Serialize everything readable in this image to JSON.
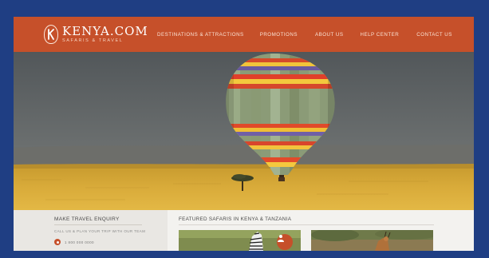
{
  "brand": {
    "name": "KENYA.COM",
    "tagline": "SAFARIS & TRAVEL",
    "logo_icon": "k-shield-logo-icon",
    "color": "#c6502a"
  },
  "nav": {
    "items": [
      {
        "label": "DESTINATIONS & ATTRACTIONS"
      },
      {
        "label": "PROMOTIONS"
      },
      {
        "label": "ABOUT US"
      },
      {
        "label": "HELP CENTER"
      },
      {
        "label": "CONTACT US"
      }
    ]
  },
  "enquiry": {
    "title": "MAKE TRAVEL ENQUIRY",
    "subtitle": "CALL US & PLAN YOUR TRIP WITH OUR TEAM",
    "phone": "1 800 000 0000",
    "phone_icon": "phone-icon"
  },
  "featured": {
    "title": "FEATURED SAFARIS IN KENYA & TANZANIA",
    "cards": [
      {
        "image": "zebra",
        "badge_icon": "user-icon"
      },
      {
        "image": "antelope"
      }
    ]
  },
  "colors": {
    "accent": "#c6502a",
    "outer_border": "#1f3e83"
  }
}
